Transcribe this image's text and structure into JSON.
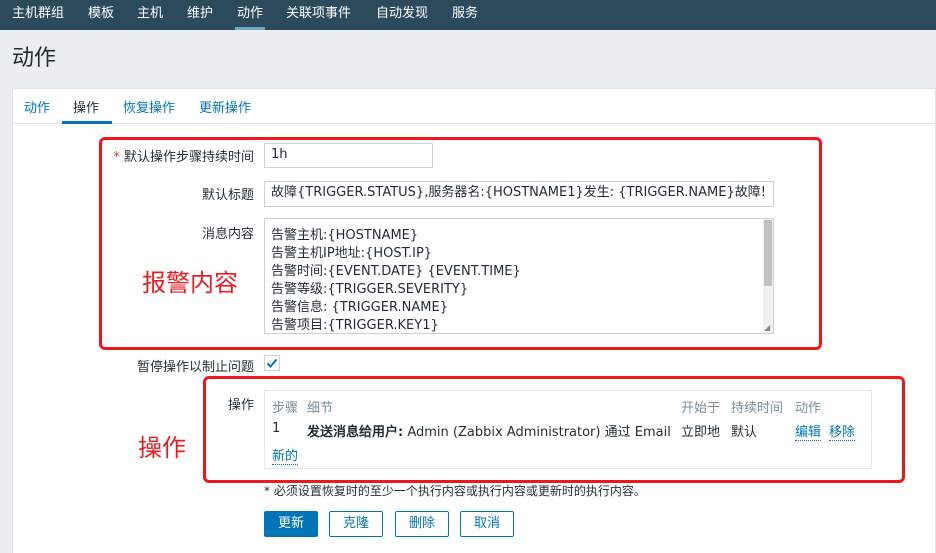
{
  "top_nav": {
    "items": [
      "主机群组",
      "模板",
      "主机",
      "维护",
      "动作",
      "关联项事件",
      "自动发现",
      "服务"
    ],
    "active": "动作"
  },
  "page": {
    "title": "动作"
  },
  "tabs": {
    "items": [
      "动作",
      "操作",
      "恢复操作",
      "更新操作"
    ],
    "active": "操作"
  },
  "form": {
    "duration": {
      "label": "默认操作步骤持续时间",
      "required_mark": "*",
      "value": "1h"
    },
    "subject": {
      "label": "默认标题",
      "value": "故障{TRIGGER.STATUS},服务器名:{HOSTNAME1}发生: {TRIGGER.NAME}故障!"
    },
    "message": {
      "label": "消息内容",
      "lines": [
        "告警主机:{HOSTNAME}",
        "告警主机IP地址:{HOST.IP}",
        "告警时间:{EVENT.DATE} {EVENT.TIME}",
        "告警等级:{TRIGGER.SEVERITY}",
        "告警信息: {TRIGGER.NAME}",
        "告警项目:{TRIGGER.KEY1}"
      ]
    },
    "pause": {
      "label": "暂停操作以制止问题",
      "checked": true
    },
    "operations": {
      "label": "操作",
      "headers": {
        "step": "步骤",
        "details": "细节",
        "start_in": "开始于",
        "duration": "持续时间",
        "action": "动作"
      },
      "rows": [
        {
          "step": "1",
          "details_bold": "发送消息给用户:",
          "details_rest": " Admin (Zabbix Administrator) 通过 Email",
          "start_in": "立即地",
          "duration": "默认",
          "edit": "编辑",
          "remove": "移除"
        }
      ],
      "new_link": "新的"
    },
    "note": "* 必须设置恢复时的至少一个执行内容或执行内容或更新时的执行内容。"
  },
  "buttons": {
    "update": "更新",
    "clone": "克隆",
    "delete": "删除",
    "cancel": "取消"
  },
  "annotations": {
    "alert_content": "报警内容",
    "operations": "操作"
  },
  "colors": {
    "nav_bg": "#2b4b5c",
    "link": "#0275b8",
    "annotation_red": "#f0171c",
    "primary_button": "#0275b8"
  }
}
